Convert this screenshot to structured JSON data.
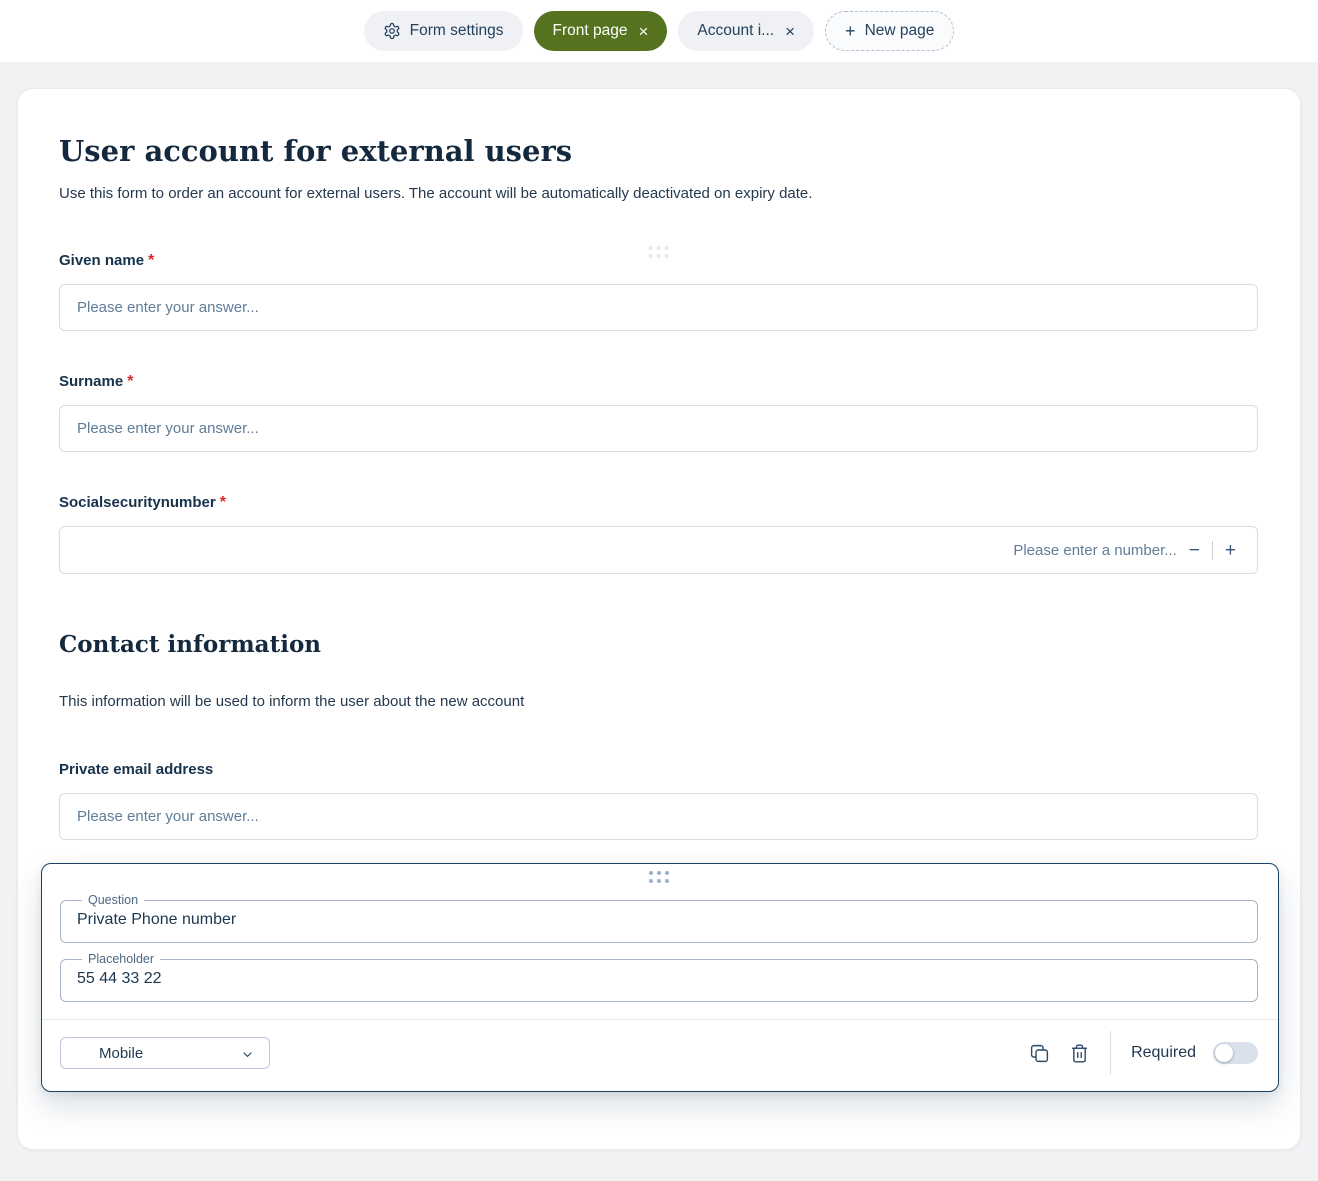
{
  "topbar": {
    "form_settings_label": "Form settings",
    "front_page_label": "Front page",
    "account_tab_label": "Account i...",
    "new_page_label": "New page",
    "close_glyph": "×",
    "plus_glyph": "+"
  },
  "page": {
    "title": "User account for external users",
    "description": "Use this form to order an account for external users. The account will be automatically deactivated on expiry date.",
    "required_mark": "*",
    "fields": {
      "given_name": {
        "label": "Given name",
        "placeholder": "Please enter your answer..."
      },
      "surname": {
        "label": "Surname",
        "placeholder": "Please enter your answer..."
      },
      "ssn": {
        "label": "Socialsecuritynumber",
        "placeholder": "Please enter a number...",
        "minus_glyph": "−",
        "plus_glyph": "+"
      }
    },
    "contact_section": {
      "title": "Contact information",
      "description": "This information will be used to inform the user about the new account"
    },
    "email": {
      "label": "Private email address",
      "placeholder": "Please enter your answer..."
    }
  },
  "editor": {
    "question_label": "Question",
    "question_value": "Private Phone number",
    "placeholder_label": "Placeholder",
    "placeholder_value": "55 44 33 22",
    "type_value": "Mobile",
    "required_label": "Required",
    "required_state": "off"
  },
  "colors": {
    "accent_green": "#55731f",
    "text_navy": "#1c374f",
    "required_red": "#d42a2a",
    "page_background": "#f1f2f4"
  }
}
